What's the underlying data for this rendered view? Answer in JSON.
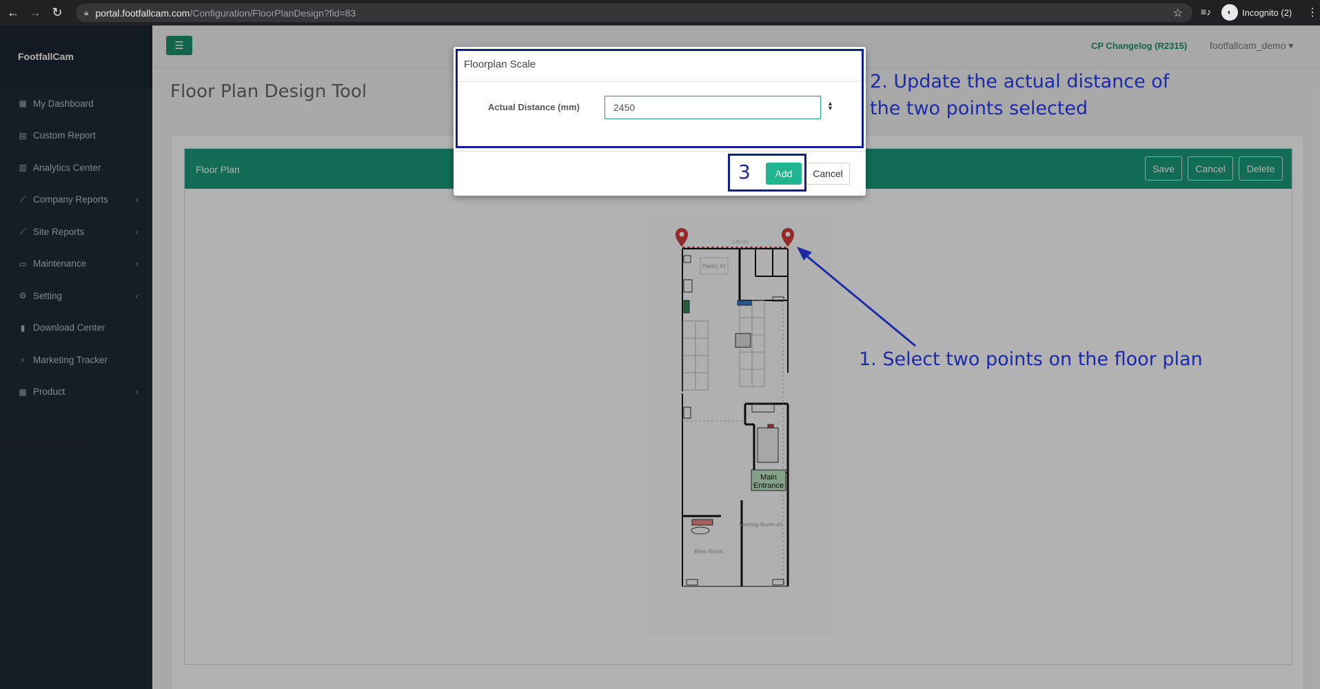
{
  "browser": {
    "url_host": "portal.footfallcam.com",
    "url_path": "/Configuration/FloorPlanDesign?fid=83",
    "incognito_label": "Incognito (2)",
    "icons": [
      "back-icon",
      "forward-icon",
      "reload-icon",
      "lock-icon",
      "star-icon",
      "media-icon",
      "incognito-icon",
      "kebab-icon"
    ]
  },
  "sidebar": {
    "brand": "FootfallCam",
    "items": [
      {
        "label": "My Dashboard",
        "icon": "grid-icon",
        "has_submenu": false
      },
      {
        "label": "Custom Report",
        "icon": "file-icon",
        "has_submenu": false
      },
      {
        "label": "Analytics Center",
        "icon": "chart-icon",
        "has_submenu": false
      },
      {
        "label": "Company Reports",
        "icon": "line-chart-icon",
        "has_submenu": true
      },
      {
        "label": "Site Reports",
        "icon": "line-chart-icon",
        "has_submenu": true
      },
      {
        "label": "Maintenance",
        "icon": "monitor-icon",
        "has_submenu": true
      },
      {
        "label": "Setting",
        "icon": "cogs-icon",
        "has_submenu": true
      },
      {
        "label": "Download Center",
        "icon": "book-icon",
        "has_submenu": false
      },
      {
        "label": "Marketing Tracker",
        "icon": "search-icon",
        "has_submenu": false
      },
      {
        "label": "Product",
        "icon": "grid-icon",
        "has_submenu": true
      }
    ]
  },
  "topbar": {
    "changelog": "CP Changelog (R2315)",
    "user": "footfallcam_demo"
  },
  "page": {
    "title": "Floor Plan Design Tool"
  },
  "floor_plan": {
    "title": "Floor Plan",
    "save_label": "Save",
    "cancel_label": "Cancel",
    "delete_label": "Delete",
    "measure_label": "245cm",
    "room_labels": {
      "pantry": "Pantry #1",
      "main_entrance_1": "Main",
      "main_entrance_2": "Entrance",
      "meeting_room": "Meeting Room #1",
      "boss_room": "Boss Room"
    }
  },
  "modal": {
    "title": "Floorplan Scale",
    "distance_label": "Actual Distance (mm)",
    "distance_value": "2450",
    "add_label": "Add",
    "cancel_label": "Cancel"
  },
  "annotations": {
    "step1": "1. Select two points on the floor plan",
    "step2_line1": "2. Update the actual distance of",
    "step2_line2": "the two points selected",
    "step3": "3",
    "color": "#1c2aa8"
  },
  "colors": {
    "brand_green": "#1a9a79",
    "sidebar_bg": "#1f2a36",
    "pin_red": "#d63a3a"
  }
}
